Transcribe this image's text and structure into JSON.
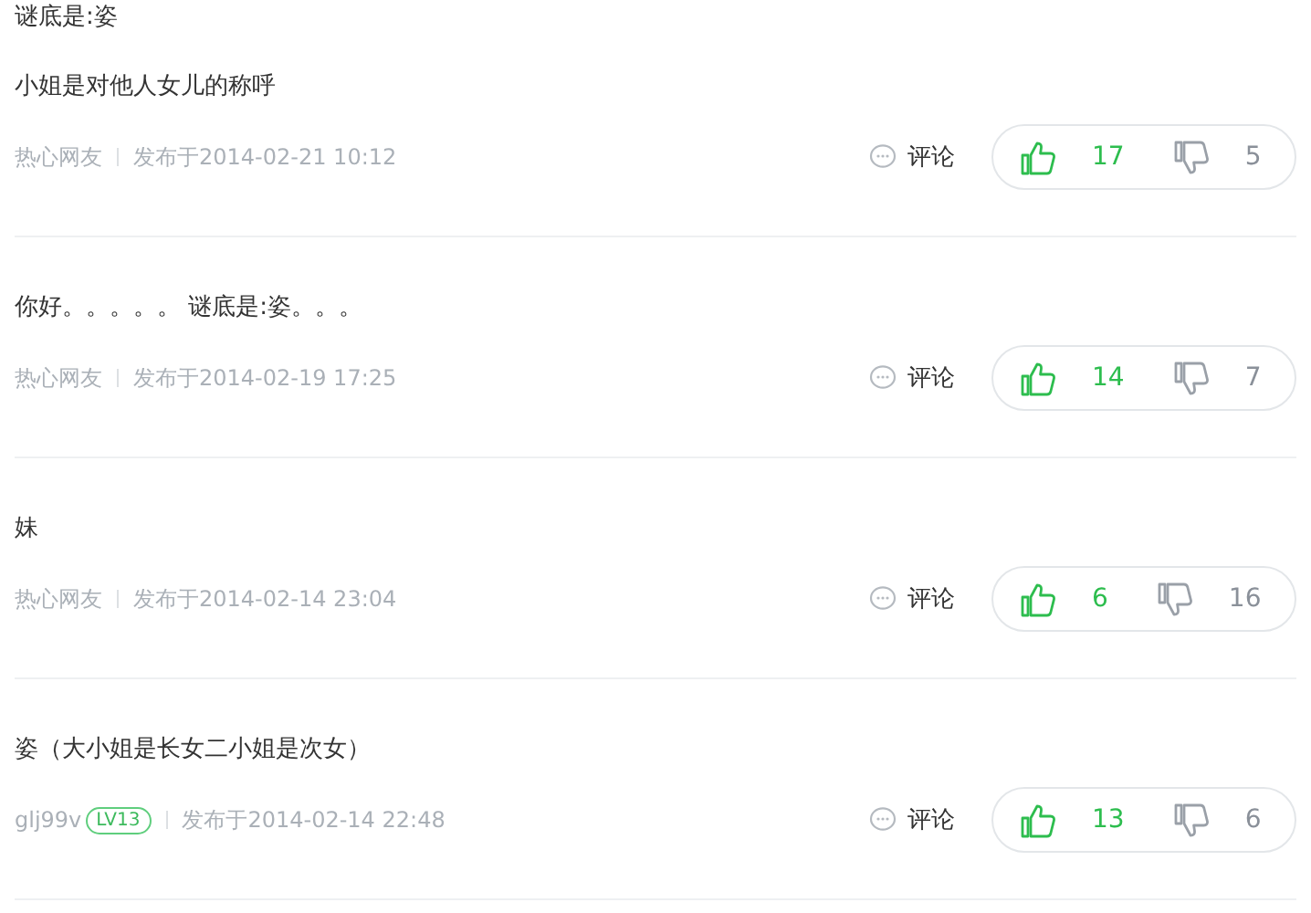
{
  "answers": [
    {
      "paragraphs": [
        "谜底是:姿",
        "小姐是对他人女儿的称呼"
      ],
      "user": "热心网友",
      "date": "发布于2014-02-21 10:12",
      "comment": "评论",
      "likes": "17",
      "dislikes": "5"
    },
    {
      "paragraphs": [
        "你好。。。。。 谜底是:姿。。。"
      ],
      "user": "热心网友",
      "date": "发布于2014-02-19 17:25",
      "comment": "评论",
      "likes": "14",
      "dislikes": "7"
    },
    {
      "paragraphs": [
        "妹"
      ],
      "user": "热心网友",
      "date": "发布于2014-02-14 23:04",
      "comment": "评论",
      "likes": "6",
      "dislikes": "16"
    },
    {
      "paragraphs": [
        "姿（大小姐是长女二小姐是次女）"
      ],
      "user": "glj99v",
      "level_badge": "LV13",
      "date": "发布于2014-02-14 22:48",
      "comment": "评论",
      "likes": "13",
      "dislikes": "6"
    }
  ]
}
